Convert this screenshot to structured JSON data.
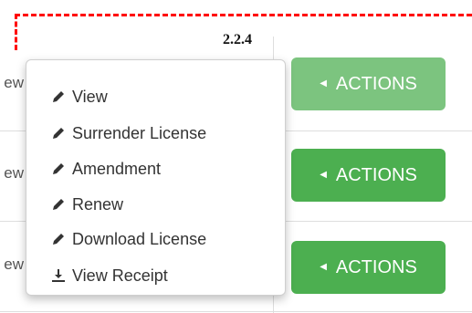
{
  "annotation": {
    "label": "2.2.4",
    "color": "#ff0000"
  },
  "rows": [
    {
      "partial_text": "ew",
      "action_button": "ACTIONS"
    },
    {
      "partial_text": "ew",
      "action_button": "ACTIONS"
    },
    {
      "partial_text": "ew",
      "action_button": "ACTIONS"
    }
  ],
  "dropdown_menu": {
    "items": [
      {
        "icon": "pencil-icon",
        "label": "View"
      },
      {
        "icon": "pencil-icon",
        "label": "Surrender License"
      },
      {
        "icon": "pencil-icon",
        "label": "Amendment"
      },
      {
        "icon": "pencil-icon",
        "label": "Renew"
      },
      {
        "icon": "pencil-icon",
        "label": "Download License"
      },
      {
        "icon": "download-icon",
        "label": "View Receipt"
      }
    ]
  },
  "colors": {
    "button_green": "#4caf50",
    "button_green_active": "#7cc47f",
    "text": "#333333"
  }
}
